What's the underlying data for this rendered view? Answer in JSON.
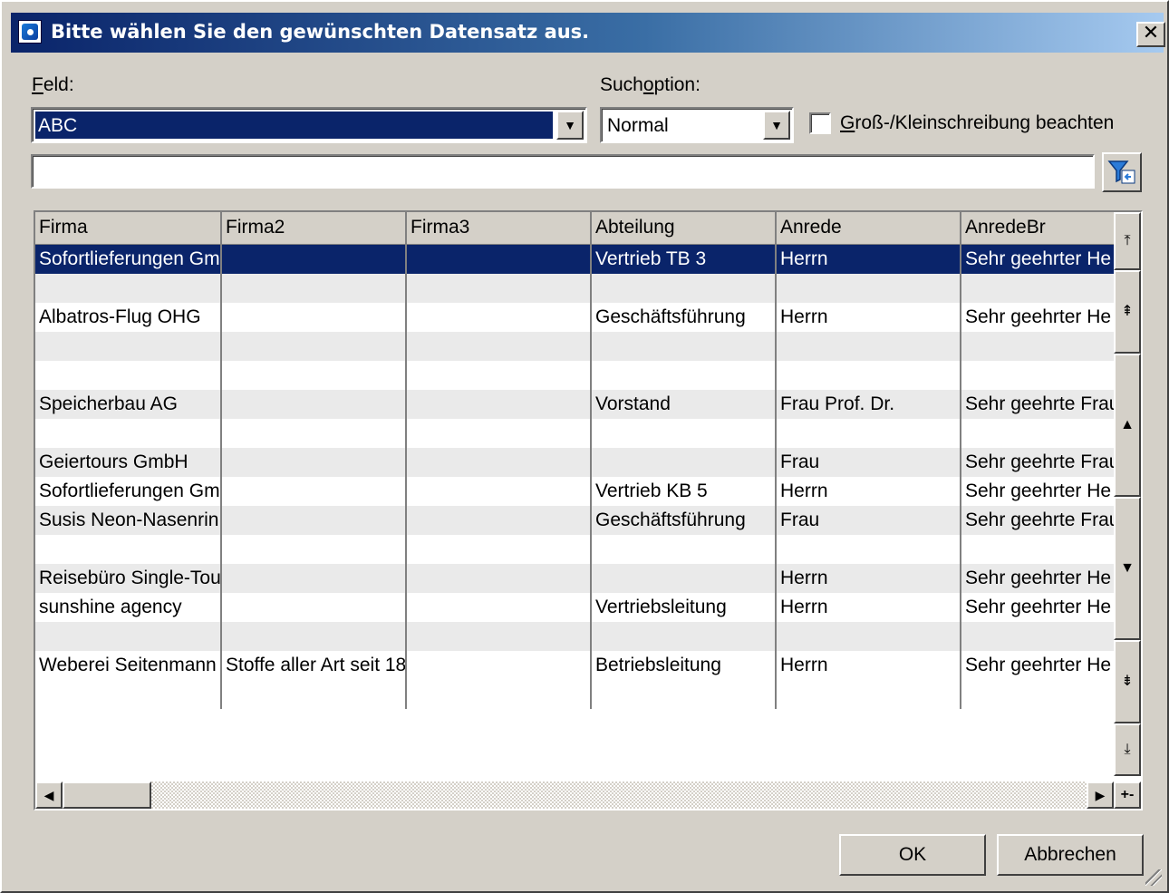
{
  "window": {
    "title": "Bitte wählen Sie den gewünschten Datensatz aus.",
    "close_symbol": "✕"
  },
  "feld": {
    "label_accel": "F",
    "label_rest": "eld:",
    "value": "ABC"
  },
  "suchoption": {
    "label_pre": "Such",
    "label_accel": "o",
    "label_post": "ption:",
    "value": "Normal"
  },
  "case_sensitive": {
    "label_accel": "G",
    "label_rest": "roß-/Kleinschreibung beachten",
    "checked": false
  },
  "search_text": "",
  "grid": {
    "columns": [
      "Firma",
      "Firma2",
      "Firma3",
      "Abteilung",
      "Anrede",
      "AnredeBr"
    ],
    "rows": [
      [
        "Sofortlieferungen Gm",
        "",
        "",
        "Vertrieb TB 3",
        "Herrn",
        "Sehr geehrter He"
      ],
      [
        "",
        "",
        "",
        "",
        "",
        ""
      ],
      [
        "Albatros-Flug OHG",
        "",
        "",
        "Geschäftsführung",
        "Herrn",
        "Sehr geehrter He"
      ],
      [
        "",
        "",
        "",
        "",
        "",
        ""
      ],
      [
        "",
        "",
        "",
        "",
        "",
        ""
      ],
      [
        "Speicherbau AG",
        "",
        "",
        "Vorstand",
        "Frau Prof. Dr.",
        "Sehr geehrte Frau"
      ],
      [
        "",
        "",
        "",
        "",
        "",
        ""
      ],
      [
        "Geiertours GmbH",
        "",
        "",
        "",
        "Frau",
        "Sehr geehrte Frau"
      ],
      [
        "Sofortlieferungen Gm",
        "",
        "",
        "Vertrieb KB 5",
        "Herrn",
        "Sehr geehrter He"
      ],
      [
        "Susis Neon-Nasenrin",
        "",
        "",
        "Geschäftsführung",
        "Frau",
        "Sehr geehrte Frau"
      ],
      [
        "",
        "",
        "",
        "",
        "",
        ""
      ],
      [
        "Reisebüro Single-Tou",
        "",
        "",
        "",
        "Herrn",
        "Sehr geehrter He"
      ],
      [
        "sunshine agency",
        "",
        "",
        "Vertriebsleitung",
        "Herrn",
        "Sehr geehrter He"
      ],
      [
        "",
        "",
        "",
        "",
        "",
        ""
      ],
      [
        "Weberei Seitenmann",
        "Stoffe aller Art seit 18",
        "",
        "Betriebsleitung",
        "Herrn",
        "Sehr geehrter He"
      ]
    ],
    "selected_row": 0
  },
  "nav": {
    "first": "⤒",
    "page_up": "⇞",
    "up": "▲",
    "down": "▼",
    "page_down": "⇟",
    "last": "⤓",
    "left": "◀",
    "right": "▶",
    "plusminus": "+-"
  },
  "buttons": {
    "ok": "OK",
    "cancel": "Abbrechen"
  },
  "colors": {
    "selection": "#0a246a",
    "face": "#d4d0c8",
    "stripe": "#eaeaea"
  }
}
